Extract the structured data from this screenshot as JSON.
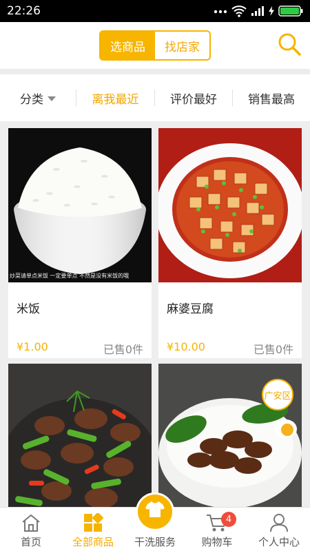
{
  "status_bar": {
    "time": "22:26"
  },
  "header": {
    "segments": [
      {
        "label": "选商品",
        "active": true
      },
      {
        "label": "找店家",
        "active": false
      }
    ]
  },
  "filters": {
    "category": "分类",
    "nearest": "离我最近",
    "best_rated": "评价最好",
    "best_selling": "销售最高"
  },
  "products": [
    {
      "name": "米饭",
      "price": "¥1.00",
      "sold": "已售0件",
      "caption": "炒菜请单点米饭 一定要单点 不然是没有米饭的哦"
    },
    {
      "name": "麻婆豆腐",
      "price": "¥10.00",
      "sold": "已售0件"
    },
    {
      "name": "",
      "price": "",
      "sold": ""
    },
    {
      "name": "",
      "price": "",
      "sold": "",
      "area_badge": "广安区"
    }
  ],
  "tabbar": {
    "home": "首页",
    "all_goods": "全部商品",
    "dry_clean": "干洗服务",
    "cart": "购物车",
    "cart_count": "4",
    "profile": "个人中心"
  },
  "colors": {
    "accent": "#f7b500",
    "badge_red": "#f14b3a"
  }
}
